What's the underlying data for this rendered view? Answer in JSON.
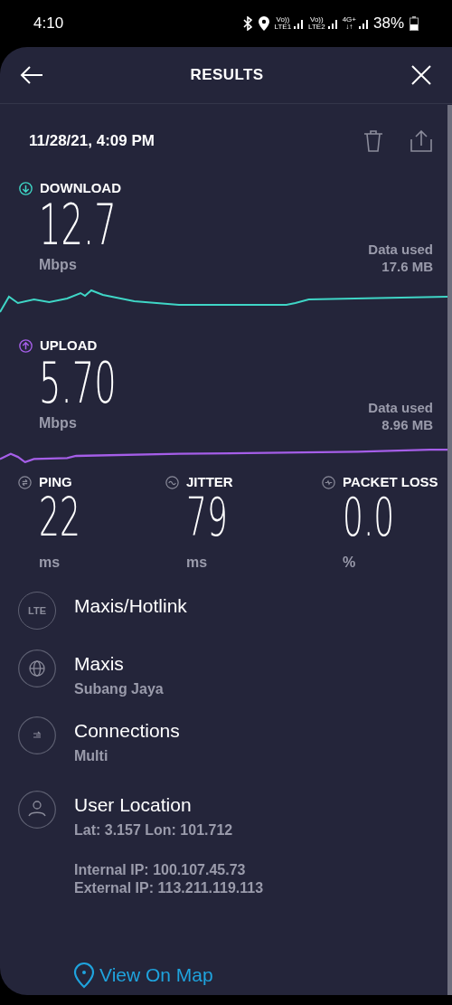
{
  "status_bar": {
    "time": "4:10",
    "networks": [
      {
        "top": "Vo))",
        "bottom": "LTE1"
      },
      {
        "top": "Vo))",
        "bottom": "LTE2"
      },
      {
        "top": "4G+",
        "bottom": "↓↑"
      }
    ],
    "battery": "38%"
  },
  "header": {
    "title": "RESULTS"
  },
  "date": "11/28/21, 4:09 PM",
  "speeds": [
    {
      "kind": "download",
      "label": "DOWNLOAD",
      "value": "12.7",
      "unit": "Mbps",
      "data_label": "Data used",
      "data_value": "17.6 MB",
      "color": "#3fd6c6"
    },
    {
      "kind": "upload",
      "label": "UPLOAD",
      "value": "5.70",
      "unit": "Mbps",
      "data_label": "Data used",
      "data_value": "8.96 MB",
      "color": "#a55ee8"
    }
  ],
  "metrics": [
    {
      "kind": "ping",
      "label": "PING",
      "value": "22",
      "unit": "ms"
    },
    {
      "kind": "jitter",
      "label": "JITTER",
      "value": "79",
      "unit": "ms"
    },
    {
      "kind": "loss",
      "label": "PACKET LOSS",
      "value": "0.0",
      "unit": "%"
    }
  ],
  "info": [
    {
      "kind": "lte",
      "icon_text": "LTE",
      "title": "Maxis/Hotlink"
    },
    {
      "kind": "globe",
      "title": "Maxis",
      "subtitle": "Subang Jaya"
    },
    {
      "kind": "connections",
      "title": "Connections",
      "subtitle": "Multi"
    },
    {
      "kind": "user",
      "title": "User Location",
      "subtitle": "Lat: 3.157 Lon: 101.712"
    }
  ],
  "ips": [
    "Internal IP: 100.107.45.73",
    "External IP: 113.211.119.113"
  ],
  "map_link": "View On Map"
}
